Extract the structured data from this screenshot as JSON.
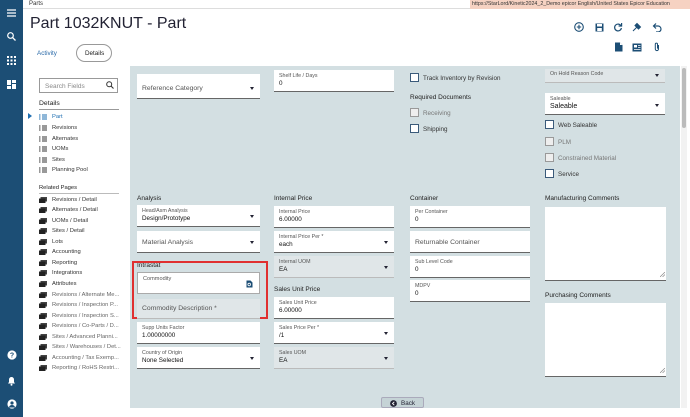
{
  "header": {
    "breadcrumb": "Parts",
    "url_info": "https://StarLord/Kinetic2024_2_Demo  epicor  English/United States  Epicor Education",
    "page_title": "Part 1032KNUT - Part"
  },
  "tabs": {
    "activity": "Activity",
    "details": "Details"
  },
  "left_panel": {
    "search_placeholder": "Search Fields",
    "details_heading": "Details",
    "details_items": [
      "Part",
      "Revisions",
      "Alternates",
      "UOMs",
      "Sites",
      "Planning Pool"
    ],
    "related_heading": "Related Pages",
    "related_items": [
      "Revisions / Detail",
      "Alternates / Detail",
      "UOMs / Detail",
      "Sites / Detail",
      "Lots",
      "Accounting",
      "Reporting",
      "Integrations",
      "Attributes",
      "Revisions / Alternate Me...",
      "Revisions / Inspection P...",
      "Revisions / Inspection S...",
      "Revisions / Co-Parts / D...",
      "Sites / Advanced Planni...",
      "Sites / Warehouses / Det...",
      "Accounting / Tax Exemp...",
      "Reporting / RoHS Restri..."
    ]
  },
  "top_section": {
    "reference_category_placeholder": "Reference Category",
    "shelf_life_label": "Shelf Life / Days",
    "shelf_life_value": "0",
    "track_inventory_label": "Track Inventory by Revision",
    "required_documents_heading": "Required Documents",
    "receiving_label": "Receiving",
    "shipping_label": "Shipping",
    "on_hold_reason_label": "On Hold Reason Code",
    "saleable_label": "Saleable",
    "saleable_value": "Saleable",
    "web_saleable_label": "Web Saleable",
    "plm_label": "PLM",
    "constrained_material_label": "Constrained Material",
    "service_label": "Service"
  },
  "analysis": {
    "heading": "Analysis",
    "head_asm_label": "Head/Asm Analysis",
    "head_asm_value": "Design/Prototype",
    "material_analysis_placeholder": "Material Analysis"
  },
  "intrastat": {
    "heading": "Intrastat",
    "commodity_label": "Commodity",
    "commodity_description_placeholder": "Commodity Description *",
    "supp_units_label": "Supp Units Factor",
    "supp_units_value": "1.00000000",
    "country_label": "Country of Origin",
    "country_value": "None Selected"
  },
  "internal_price": {
    "heading": "Internal Price",
    "price_label": "Internal Price",
    "price_value": "6.00000",
    "price_per_label": "Internal Price Per *",
    "price_per_value": "each",
    "uom_label": "Internal UOM",
    "uom_value": "EA"
  },
  "sales_unit_price": {
    "heading": "Sales Unit Price",
    "price_label": "Sales Unit Price",
    "price_value": "6.00000",
    "price_per_label": "Sales Price Per *",
    "price_per_value": "/1",
    "uom_label": "Sales UOM",
    "uom_value": "EA"
  },
  "container": {
    "heading": "Container",
    "per_container_label": "Per Container",
    "per_container_value": "0",
    "returnable_container_placeholder": "Returnable Container",
    "sub_level_label": "Sub Level Code",
    "sub_level_value": "0",
    "mdpv_label": "MDPV",
    "mdpv_value": "0"
  },
  "comments": {
    "manufacturing_heading": "Manufacturing Comments",
    "purchasing_heading": "Purchasing Comments"
  },
  "footer": {
    "back_label": "Back"
  },
  "colors": {
    "nav": "#1c4e75",
    "panel": "#d3dfe2",
    "highlight": "#e03030",
    "url_bg": "#f6d2c2"
  }
}
